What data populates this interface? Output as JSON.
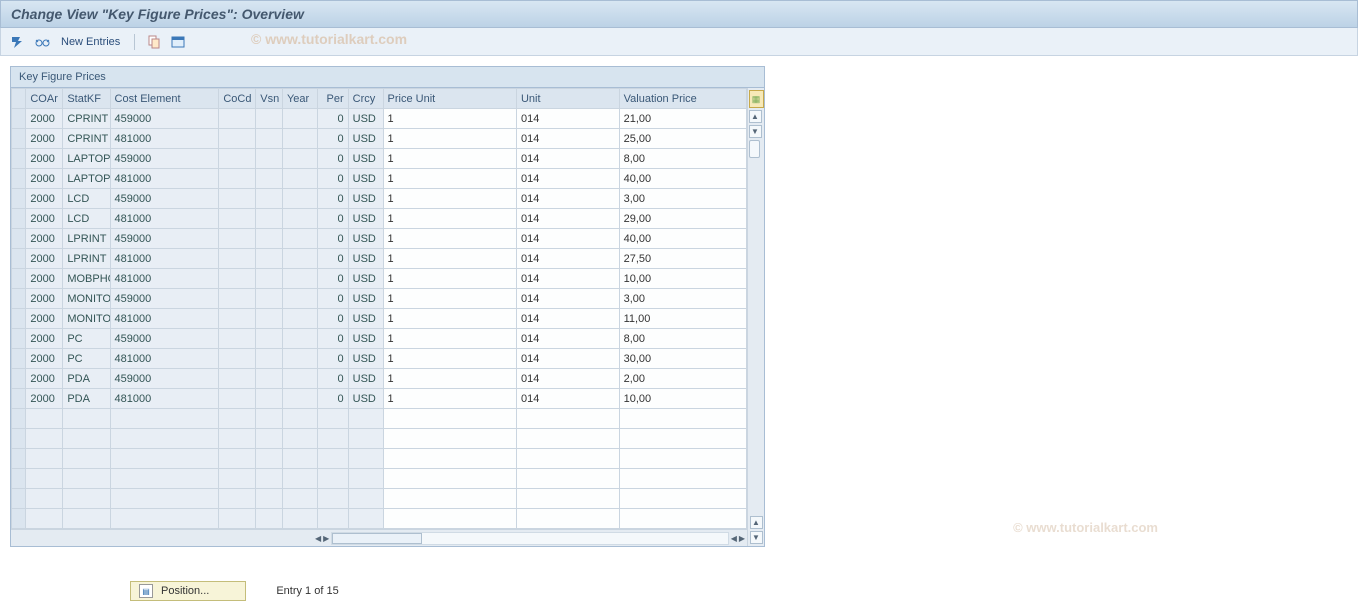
{
  "window": {
    "title": "Change View \"Key Figure Prices\": Overview"
  },
  "toolbar": {
    "new_entries": "New Entries",
    "watermark": "© www.tutorialkart.com"
  },
  "grid": {
    "panel_title": "Key Figure Prices",
    "columns": {
      "coar": "COAr",
      "statkf": "StatKF",
      "cost_element": "Cost Element",
      "cocd": "CoCd",
      "vsn": "Vsn",
      "year": "Year",
      "per": "Per",
      "crcy": "Crcy",
      "price_unit": "Price Unit",
      "unit": "Unit",
      "valuation_price": "Valuation Price"
    },
    "rows": [
      {
        "coar": "2000",
        "statkf": "CPRINT",
        "cost": "459000",
        "cocd": "",
        "vsn": "",
        "year": "",
        "per": "0",
        "crcy": "USD",
        "punit": "1",
        "unit": "014",
        "vprice": "21,00"
      },
      {
        "coar": "2000",
        "statkf": "CPRINT",
        "cost": "481000",
        "cocd": "",
        "vsn": "",
        "year": "",
        "per": "0",
        "crcy": "USD",
        "punit": "1",
        "unit": "014",
        "vprice": "25,00"
      },
      {
        "coar": "2000",
        "statkf": "LAPTOP",
        "cost": "459000",
        "cocd": "",
        "vsn": "",
        "year": "",
        "per": "0",
        "crcy": "USD",
        "punit": "1",
        "unit": "014",
        "vprice": "8,00"
      },
      {
        "coar": "2000",
        "statkf": "LAPTOP",
        "cost": "481000",
        "cocd": "",
        "vsn": "",
        "year": "",
        "per": "0",
        "crcy": "USD",
        "punit": "1",
        "unit": "014",
        "vprice": "40,00"
      },
      {
        "coar": "2000",
        "statkf": "LCD",
        "cost": "459000",
        "cocd": "",
        "vsn": "",
        "year": "",
        "per": "0",
        "crcy": "USD",
        "punit": "1",
        "unit": "014",
        "vprice": "3,00"
      },
      {
        "coar": "2000",
        "statkf": "LCD",
        "cost": "481000",
        "cocd": "",
        "vsn": "",
        "year": "",
        "per": "0",
        "crcy": "USD",
        "punit": "1",
        "unit": "014",
        "vprice": "29,00"
      },
      {
        "coar": "2000",
        "statkf": "LPRINT",
        "cost": "459000",
        "cocd": "",
        "vsn": "",
        "year": "",
        "per": "0",
        "crcy": "USD",
        "punit": "1",
        "unit": "014",
        "vprice": "40,00"
      },
      {
        "coar": "2000",
        "statkf": "LPRINT",
        "cost": "481000",
        "cocd": "",
        "vsn": "",
        "year": "",
        "per": "0",
        "crcy": "USD",
        "punit": "1",
        "unit": "014",
        "vprice": "27,50"
      },
      {
        "coar": "2000",
        "statkf": "MOBPHO",
        "cost": "481000",
        "cocd": "",
        "vsn": "",
        "year": "",
        "per": "0",
        "crcy": "USD",
        "punit": "1",
        "unit": "014",
        "vprice": "10,00"
      },
      {
        "coar": "2000",
        "statkf": "MONITO",
        "cost": "459000",
        "cocd": "",
        "vsn": "",
        "year": "",
        "per": "0",
        "crcy": "USD",
        "punit": "1",
        "unit": "014",
        "vprice": "3,00"
      },
      {
        "coar": "2000",
        "statkf": "MONITO",
        "cost": "481000",
        "cocd": "",
        "vsn": "",
        "year": "",
        "per": "0",
        "crcy": "USD",
        "punit": "1",
        "unit": "014",
        "vprice": "11,00"
      },
      {
        "coar": "2000",
        "statkf": "PC",
        "cost": "459000",
        "cocd": "",
        "vsn": "",
        "year": "",
        "per": "0",
        "crcy": "USD",
        "punit": "1",
        "unit": "014",
        "vprice": "8,00"
      },
      {
        "coar": "2000",
        "statkf": "PC",
        "cost": "481000",
        "cocd": "",
        "vsn": "",
        "year": "",
        "per": "0",
        "crcy": "USD",
        "punit": "1",
        "unit": "014",
        "vprice": "30,00"
      },
      {
        "coar": "2000",
        "statkf": "PDA",
        "cost": "459000",
        "cocd": "",
        "vsn": "",
        "year": "",
        "per": "0",
        "crcy": "USD",
        "punit": "1",
        "unit": "014",
        "vprice": "2,00"
      },
      {
        "coar": "2000",
        "statkf": "PDA",
        "cost": "481000",
        "cocd": "",
        "vsn": "",
        "year": "",
        "per": "0",
        "crcy": "USD",
        "punit": "1",
        "unit": "014",
        "vprice": "10,00"
      }
    ],
    "empty_rows": 6
  },
  "footer": {
    "position_button": "Position...",
    "entry_text": "Entry 1 of 15"
  },
  "watermark2": "© www.tutorialkart.com"
}
